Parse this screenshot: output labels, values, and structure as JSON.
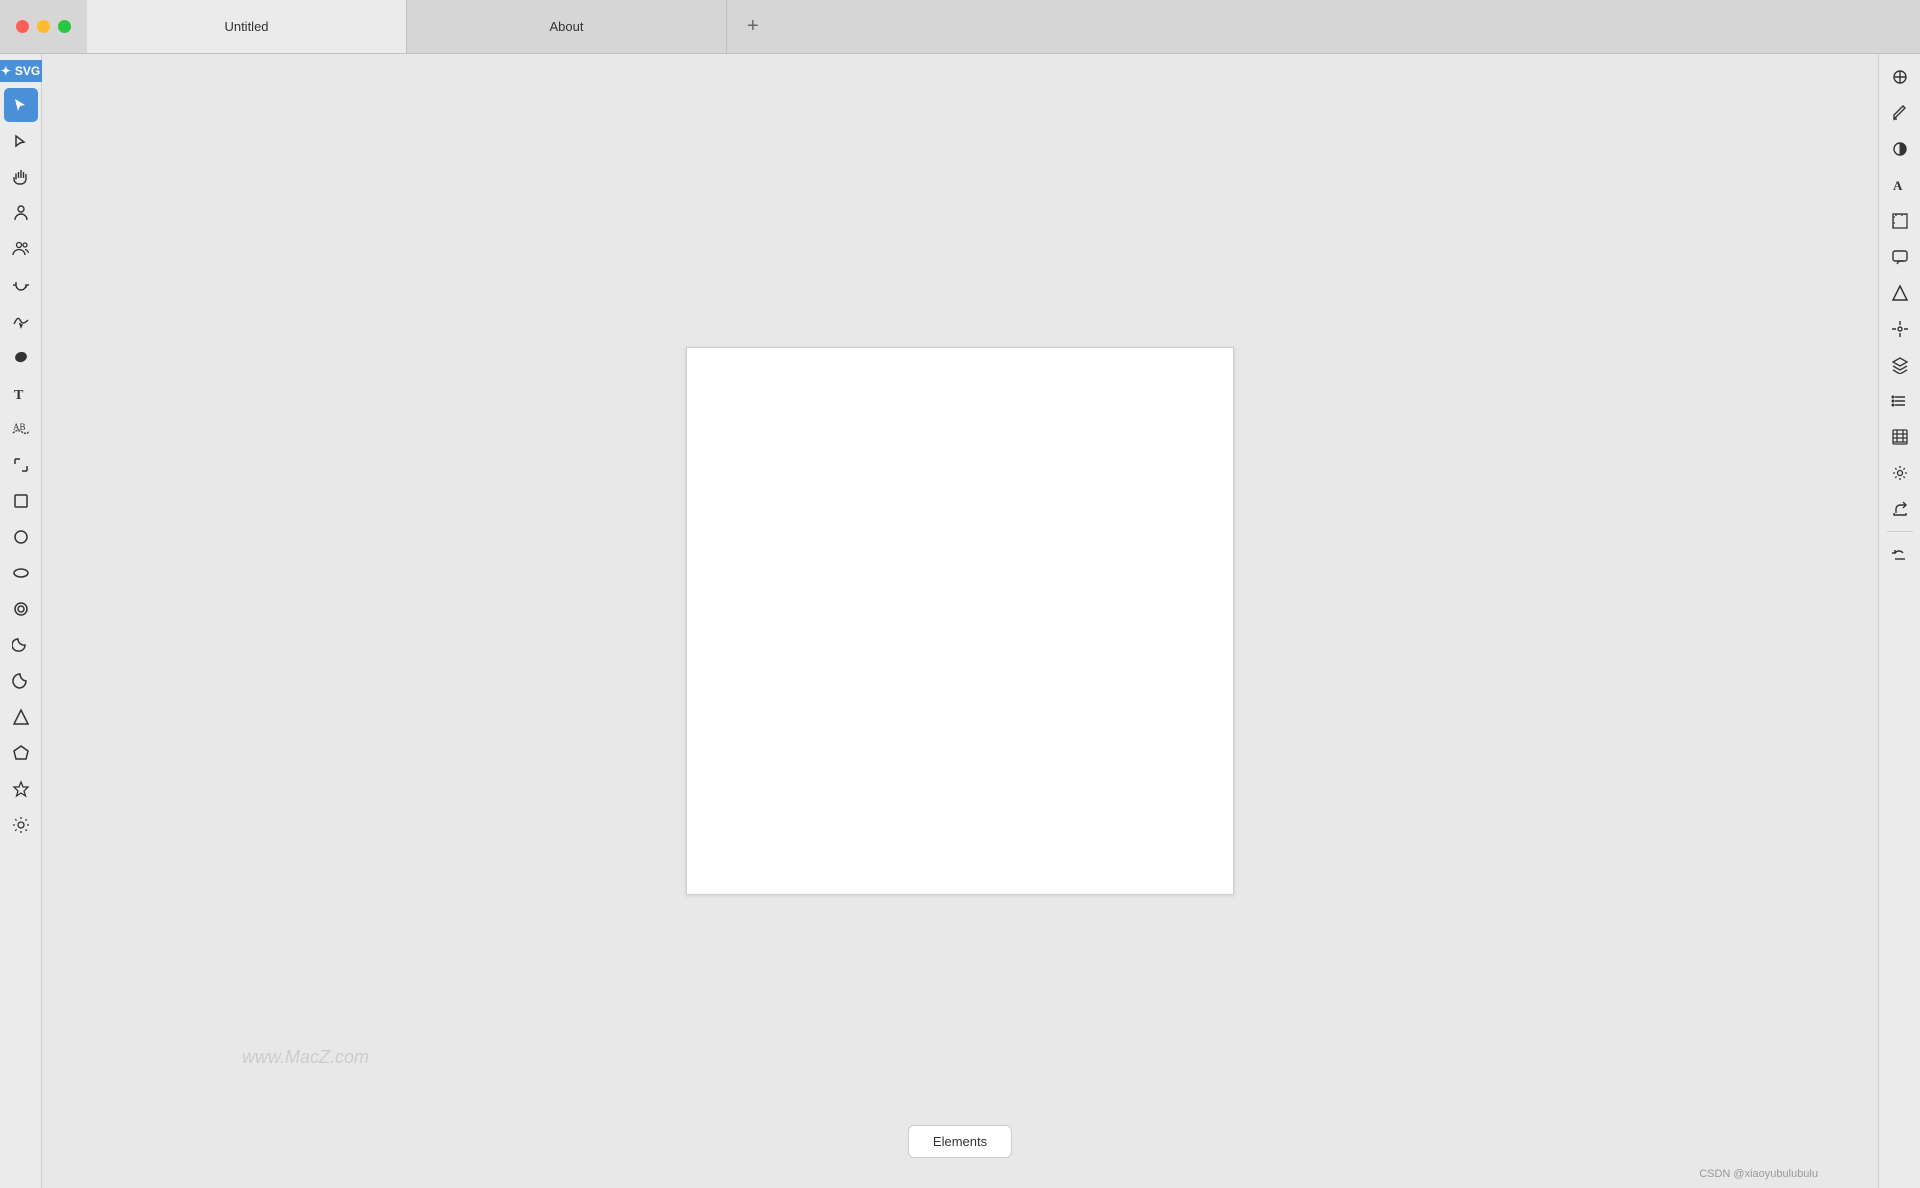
{
  "titlebar": {
    "tabs": [
      {
        "id": "untitled",
        "label": "Untitled",
        "active": true
      },
      {
        "id": "about",
        "label": "About",
        "active": false
      }
    ],
    "add_tab_label": "+"
  },
  "svg_badge": {
    "label": "SVG",
    "icon": "★"
  },
  "left_tools": [
    {
      "name": "select",
      "icon": "cursor",
      "active": true
    },
    {
      "name": "direct-select",
      "icon": "arrow"
    },
    {
      "name": "hand",
      "icon": "hand"
    },
    {
      "name": "person",
      "icon": "person"
    },
    {
      "name": "people",
      "icon": "people"
    },
    {
      "name": "loop",
      "icon": "loop"
    },
    {
      "name": "wave",
      "icon": "wave"
    },
    {
      "name": "blob",
      "icon": "blob"
    },
    {
      "name": "text",
      "icon": "text"
    },
    {
      "name": "text-path",
      "icon": "text-path"
    },
    {
      "name": "crop",
      "icon": "crop"
    },
    {
      "name": "rect",
      "icon": "rect"
    },
    {
      "name": "circle",
      "icon": "circle"
    },
    {
      "name": "ellipse",
      "icon": "ellipse"
    },
    {
      "name": "ring",
      "icon": "ring"
    },
    {
      "name": "moon",
      "icon": "moon"
    },
    {
      "name": "crescent",
      "icon": "crescent"
    },
    {
      "name": "triangle",
      "icon": "triangle"
    },
    {
      "name": "pentagon",
      "icon": "pentagon"
    },
    {
      "name": "star",
      "icon": "star"
    },
    {
      "name": "gear",
      "icon": "gear"
    }
  ],
  "right_tools": [
    {
      "name": "style",
      "icon": "style"
    },
    {
      "name": "pen",
      "icon": "pen"
    },
    {
      "name": "contrast",
      "icon": "contrast"
    },
    {
      "name": "typography",
      "icon": "typography"
    },
    {
      "name": "frame",
      "icon": "frame"
    },
    {
      "name": "comment",
      "icon": "comment"
    },
    {
      "name": "delta",
      "icon": "delta"
    },
    {
      "name": "transform",
      "icon": "transform"
    },
    {
      "name": "layers",
      "icon": "layers"
    },
    {
      "name": "list",
      "icon": "list"
    },
    {
      "name": "columns",
      "icon": "columns"
    },
    {
      "name": "settings2",
      "icon": "settings2"
    },
    {
      "name": "export",
      "icon": "export"
    },
    {
      "name": "undo-history",
      "icon": "undo-history"
    }
  ],
  "canvas": {
    "watermark": "www.MacZ.com"
  },
  "bottom": {
    "elements_label": "Elements"
  },
  "attribution": "CSDN @xiaoyubulubulu"
}
